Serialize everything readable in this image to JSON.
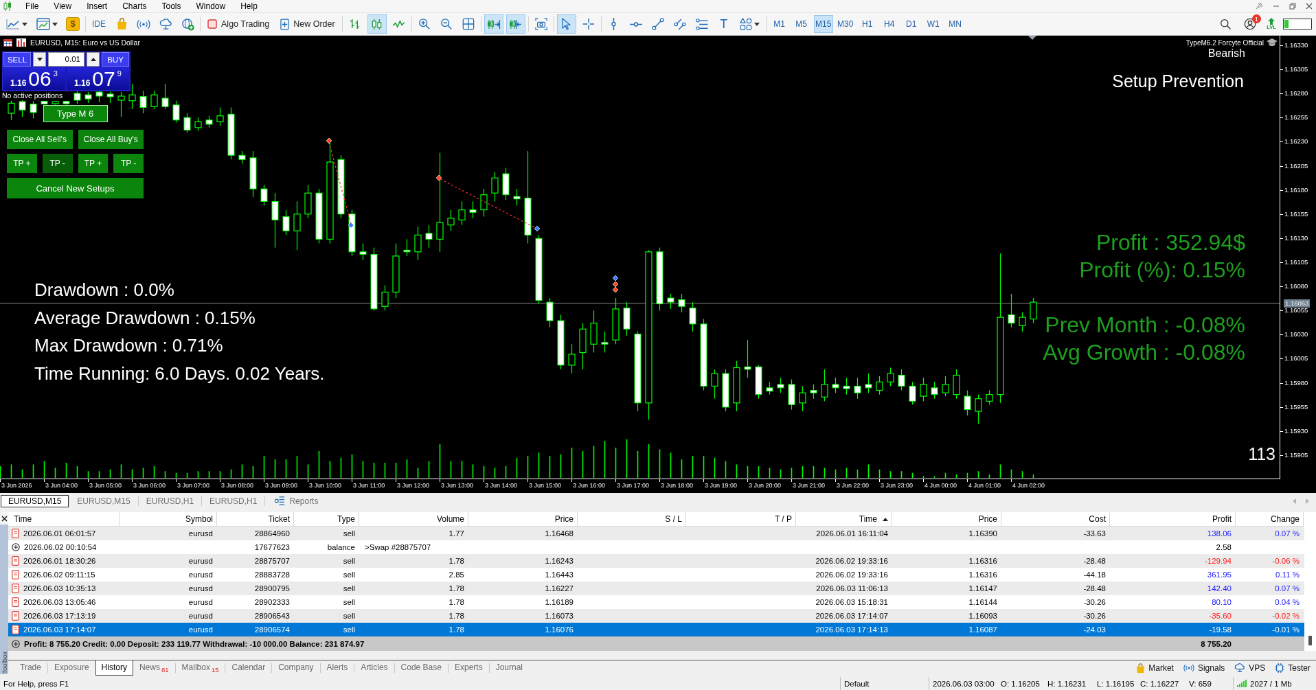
{
  "menu": {
    "items": [
      "File",
      "View",
      "Insert",
      "Charts",
      "Tools",
      "Window",
      "Help"
    ]
  },
  "toolbar": {
    "dollar": "$",
    "ide": "IDE",
    "algo_trading": {
      "label": "Algo Trading",
      "on": false
    },
    "new_order": "New Order",
    "chart_types": [
      {
        "selected": false
      },
      {
        "selected": true
      },
      {
        "selected": false
      }
    ],
    "auto_scroll": {
      "on": true
    },
    "chart_shift": {
      "on": true
    },
    "pointers": [
      {
        "selected": true
      },
      {
        "selected": false
      }
    ],
    "text_tool": "T",
    "timeframes": [
      {
        "label": "M1",
        "selected": false
      },
      {
        "label": "M5",
        "selected": false
      },
      {
        "label": "M15",
        "selected": true
      },
      {
        "label": "M30",
        "selected": false
      },
      {
        "label": "H1",
        "selected": false
      },
      {
        "label": "H4",
        "selected": false
      },
      {
        "label": "D1",
        "selected": false
      },
      {
        "label": "W1",
        "selected": false
      },
      {
        "label": "MN",
        "selected": false
      }
    ],
    "notifications": "1",
    "level_label": "LVL"
  },
  "chart": {
    "title": "EURUSD, M15: Euro vs US Dollar",
    "one_click": {
      "sell": "SELL",
      "buy": "BUY",
      "volume": "0.01",
      "bid": {
        "base": "1.16",
        "pips": "06",
        "point": "3"
      },
      "ask": {
        "base": "1.16",
        "pips": "07",
        "point": "9"
      }
    },
    "positions_note": "No active positions",
    "ea_rows": [
      {
        "buttons": [
          {
            "label": "Type M 6",
            "kind": "mode",
            "pressed": false
          }
        ]
      },
      {
        "buttons": [
          {
            "label": "Close All Sell's",
            "kind": "action",
            "pressed": false
          },
          {
            "label": "Close All Buy's",
            "kind": "action",
            "pressed": false
          }
        ]
      },
      {
        "buttons": [
          {
            "label": "TP +",
            "kind": "action",
            "pressed": false
          },
          {
            "label": "TP -",
            "kind": "action",
            "pressed": true
          },
          {
            "label": "TP +",
            "kind": "action",
            "pressed": false
          },
          {
            "label": "TP -",
            "kind": "action",
            "pressed": false
          }
        ]
      },
      {
        "buttons": [
          {
            "label": "Cancel New Setups",
            "kind": "action",
            "pressed": false
          }
        ]
      }
    ],
    "ea_name": "TypeM6.2 Forcyte Official",
    "trend": "Bearish",
    "setup": "Setup Prevention",
    "drawdown": [
      "Drawdown : 0.0%",
      "Average Drawdown : 0.15%",
      "Max Drawdown : 0.71%",
      "Time Running: 6.0 Days. 0.02 Years."
    ],
    "performance": [
      {
        "lines": [
          "Profit : 352.94$",
          "Profit (%): 0.15%"
        ]
      },
      {
        "lines": [
          "Prev Month : -0.08%",
          "Avg Growth : -0.08%"
        ]
      }
    ],
    "counter": "113",
    "price_axis": [
      "1.16330",
      "1.16305",
      "1.16280",
      "1.16255",
      "1.16230",
      "1.16205",
      "1.16180",
      "1.16155",
      "1.16130",
      "1.16105",
      "1.16080",
      "1.16055",
      "1.16030",
      "1.16005",
      "1.15980",
      "1.15955",
      "1.15930",
      "1.15905"
    ],
    "current_price": "1.16063",
    "time_axis": [
      "3 Jun 2026",
      "3 Jun 04:00",
      "3 Jun 05:00",
      "3 Jun 06:00",
      "3 Jun 07:00",
      "3 Jun 08:00",
      "3 Jun 09:00",
      "3 Jun 10:00",
      "3 Jun 11:00",
      "3 Jun 12:00",
      "3 Jun 13:00",
      "3 Jun 14:00",
      "3 Jun 15:00",
      "3 Jun 16:00",
      "3 Jun 17:00",
      "3 Jun 18:00",
      "3 Jun 19:00",
      "3 Jun 20:00",
      "3 Jun 21:00",
      "3 Jun 22:00",
      "3 Jun 23:00",
      "4 Jun 00:00",
      "4 Jun 01:00",
      "4 Jun 02:00"
    ]
  },
  "chart_tabs": [
    {
      "label": "EURUSD,M15",
      "selected": true
    },
    {
      "label": "EURUSD,M15",
      "selected": false
    },
    {
      "label": "EURUSD,H1",
      "selected": false
    },
    {
      "label": "EURUSD,H1",
      "selected": false
    }
  ],
  "reports": "Reports",
  "toolbox": {
    "title": "Toolbox",
    "columns": [
      {
        "label": "Time",
        "sorted": false
      },
      {
        "label": "Symbol",
        "sorted": false
      },
      {
        "label": "Ticket",
        "sorted": false
      },
      {
        "label": "Type",
        "sorted": false
      },
      {
        "label": "Volume",
        "sorted": false
      },
      {
        "label": "Price",
        "sorted": false
      },
      {
        "label": "S / L",
        "sorted": false
      },
      {
        "label": "T / P",
        "sorted": false
      },
      {
        "label": "Time",
        "sorted": true
      },
      {
        "label": "Price",
        "sorted": false
      },
      {
        "label": "Cost",
        "sorted": false
      },
      {
        "label": "Profit",
        "sorted": false
      },
      {
        "label": "Change",
        "sorted": false
      }
    ],
    "rows": [
      {
        "kind": "deal",
        "time": "2026.06.01 06:01:57",
        "symbol": "eurusd",
        "ticket": "28864960",
        "type": "sell",
        "volume": "1.77",
        "price": "1.16468",
        "close_time": "2026.06.01 16:11:04",
        "close_price": "1.16390",
        "cost": "-33.63",
        "profit": "138.06",
        "change": "0.07 %",
        "color": "#1a1aff",
        "selected": false
      },
      {
        "kind": "balance",
        "time": "2026.06.02 00:10:54",
        "ticket": "17677623",
        "type": "balance",
        "comment": ">Swap #28875707",
        "profit": "2.58",
        "selected": false
      },
      {
        "kind": "deal",
        "time": "2026.06.01 18:30:26",
        "symbol": "eurusd",
        "ticket": "28875707",
        "type": "sell",
        "volume": "1.78",
        "price": "1.16243",
        "close_time": "2026.06.02 19:33:16",
        "close_price": "1.16316",
        "cost": "-28.48",
        "profit": "-129.94",
        "change": "-0.06 %",
        "color": "#ff1a1a",
        "selected": false
      },
      {
        "kind": "deal",
        "time": "2026.06.02 09:11:15",
        "symbol": "eurusd",
        "ticket": "28883728",
        "type": "sell",
        "volume": "2.85",
        "price": "1.16443",
        "close_time": "2026.06.02 19:33:16",
        "close_price": "1.16316",
        "cost": "-44.18",
        "profit": "361.95",
        "change": "0.11 %",
        "color": "#1a1aff",
        "selected": false
      },
      {
        "kind": "deal",
        "time": "2026.06.03 10:35:13",
        "symbol": "eurusd",
        "ticket": "28900795",
        "type": "sell",
        "volume": "1.78",
        "price": "1.16227",
        "close_time": "2026.06.03 11:06:13",
        "close_price": "1.16147",
        "cost": "-28.48",
        "profit": "142.40",
        "change": "0.07 %",
        "color": "#1a1aff",
        "selected": false
      },
      {
        "kind": "deal",
        "time": "2026.06.03 13:05:46",
        "symbol": "eurusd",
        "ticket": "28902333",
        "type": "sell",
        "volume": "1.78",
        "price": "1.16189",
        "close_time": "2026.06.03 15:18:31",
        "close_price": "1.16144",
        "cost": "-30.26",
        "profit": "80.10",
        "change": "0.04 %",
        "color": "#1a1aff",
        "selected": false
      },
      {
        "kind": "deal",
        "time": "2026.06.03 17:13:19",
        "symbol": "eurusd",
        "ticket": "28906543",
        "type": "sell",
        "volume": "1.78",
        "price": "1.16073",
        "close_time": "2026.06.03 17:14:07",
        "close_price": "1.16093",
        "cost": "-30.26",
        "profit": "-35.60",
        "change": "-0.02 %",
        "color": "#ff1a1a",
        "selected": false
      },
      {
        "kind": "deal",
        "time": "2026.06.03 17:14:07",
        "symbol": "eurusd",
        "ticket": "28906574",
        "type": "sell",
        "volume": "1.78",
        "price": "1.16076",
        "close_time": "2026.06.03 17:14:13",
        "close_price": "1.16087",
        "cost": "-24.03",
        "profit": "-19.58",
        "change": "-0.01 %",
        "selected": true
      }
    ],
    "summary": {
      "text": "Profit: 8 755.20 Credit: 0.00 Deposit: 233 119.77 Withdrawal: -10 000.00 Balance: 231 874.97",
      "profit": "8 755.20"
    },
    "tabs": [
      {
        "label": "Trade",
        "selected": false
      },
      {
        "label": "Exposure",
        "selected": false
      },
      {
        "label": "History",
        "selected": true
      },
      {
        "label": "News",
        "badge": "81",
        "selected": false
      },
      {
        "label": "Mailbox",
        "badge": "15",
        "selected": false
      },
      {
        "label": "Calendar",
        "selected": false
      },
      {
        "label": "Company",
        "selected": false
      },
      {
        "label": "Alerts",
        "selected": false
      },
      {
        "label": "Articles",
        "selected": false
      },
      {
        "label": "Code Base",
        "selected": false
      },
      {
        "label": "Experts",
        "selected": false
      },
      {
        "label": "Journal",
        "selected": false
      }
    ],
    "services": [
      "Market",
      "Signals",
      "VPS",
      "Tester"
    ]
  },
  "status_bar": {
    "help": "For Help, press F1",
    "profile": "Default",
    "time": "2026.06.03 03:00",
    "open": "O: 1.16205",
    "high": "H: 1.16231",
    "low": "L: 1.16195",
    "close": "C: 1.16227",
    "volume": "V: 659",
    "traffic": "2027 / 1 Mb"
  }
}
